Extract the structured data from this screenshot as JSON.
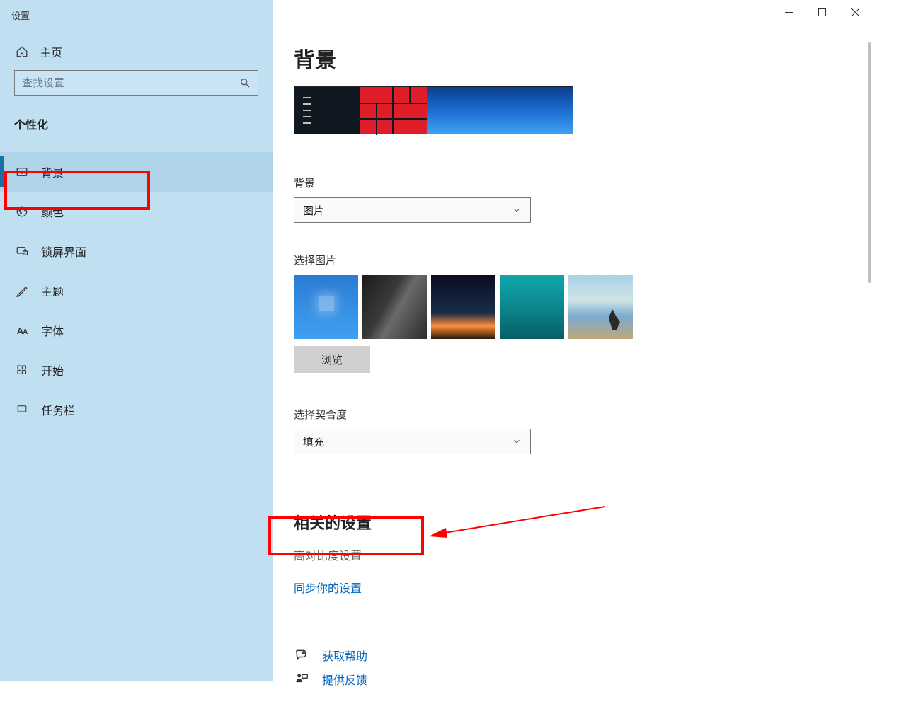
{
  "window": {
    "title": "设置"
  },
  "sidebar": {
    "home": "主页",
    "searchPlaceholder": "查找设置",
    "group": "个性化",
    "items": [
      {
        "label": "背景",
        "icon": "picture-icon",
        "active": true
      },
      {
        "label": "颜色",
        "icon": "palette-icon"
      },
      {
        "label": "锁屏界面",
        "icon": "lock-screen-icon"
      },
      {
        "label": "主题",
        "icon": "theme-icon"
      },
      {
        "label": "字体",
        "icon": "font-icon"
      },
      {
        "label": "开始",
        "icon": "start-icon"
      },
      {
        "label": "任务栏",
        "icon": "taskbar-icon"
      }
    ]
  },
  "main": {
    "title": "背景",
    "bgLabel": "背景",
    "bgValue": "图片",
    "chooseLabel": "选择图片",
    "browse": "浏览",
    "fitLabel": "选择契合度",
    "fitValue": "填充",
    "relatedTitle": "相关的设置",
    "highContrast": "高对比度设置",
    "sync": "同步你的设置",
    "getHelp": "获取帮助",
    "feedback": "提供反馈"
  }
}
